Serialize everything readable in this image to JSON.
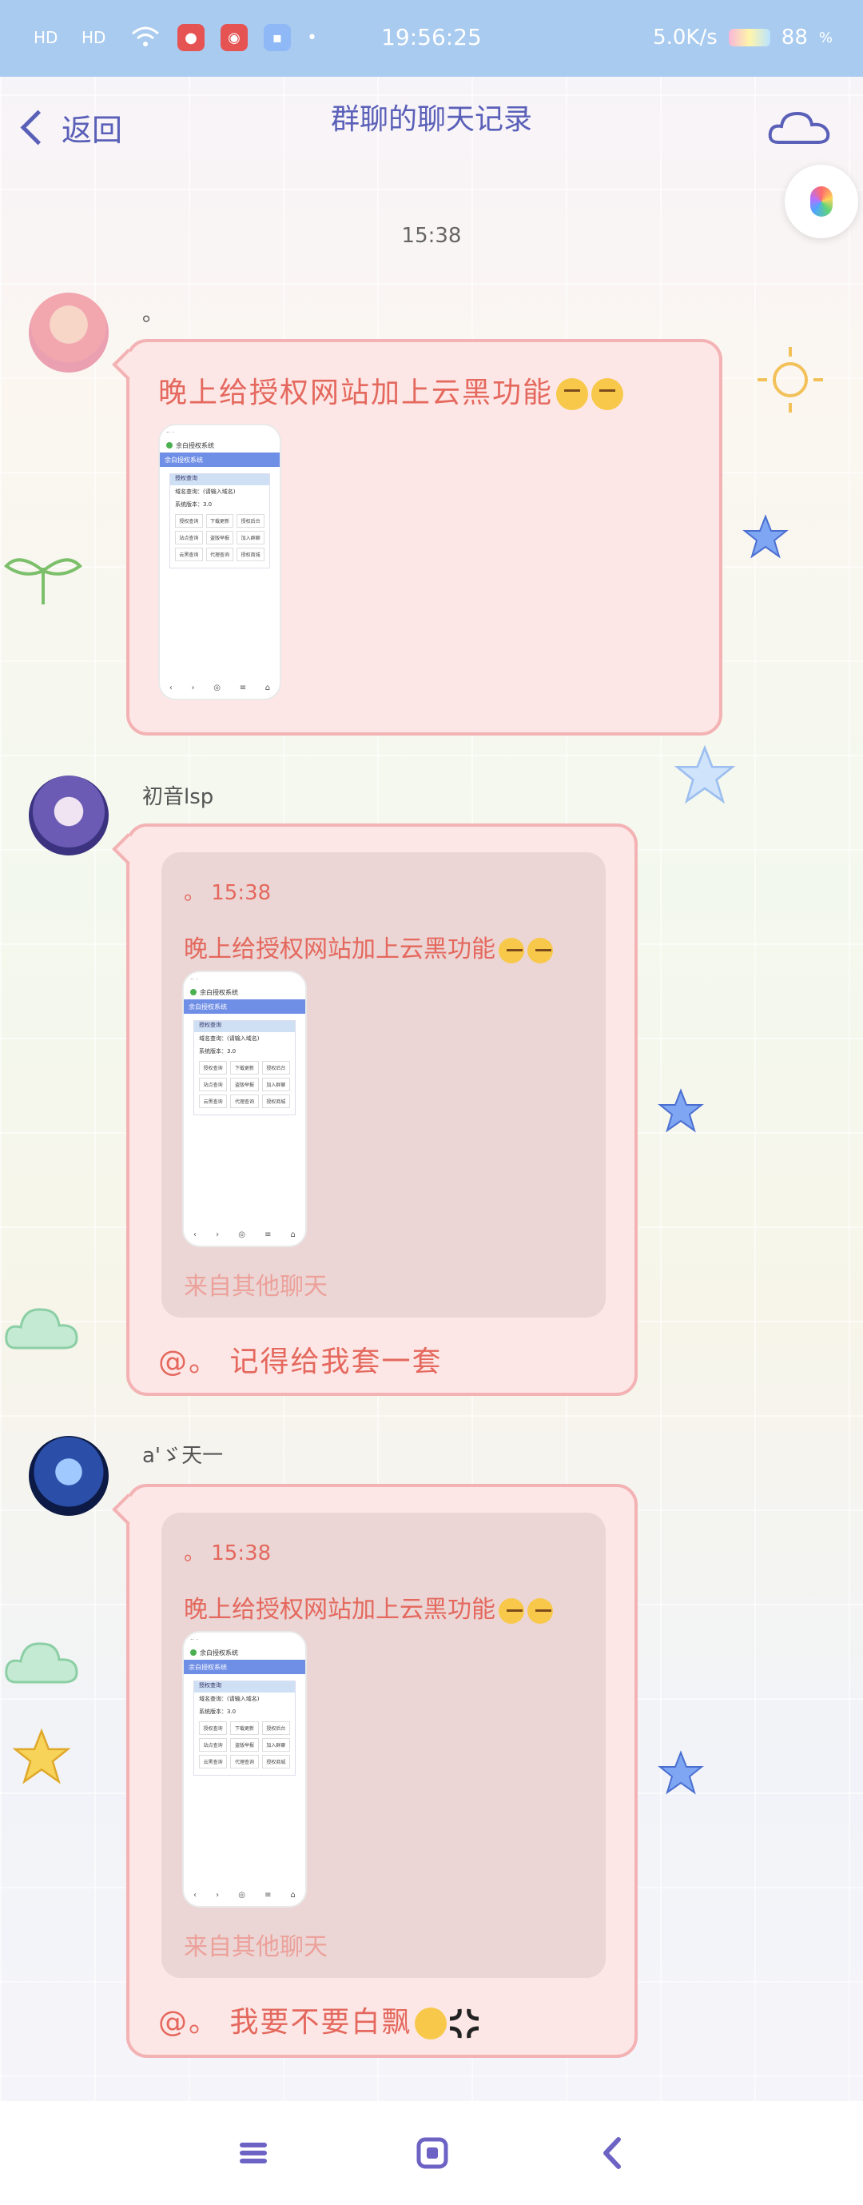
{
  "status_bar": {
    "signal_1": "HD",
    "signal_2": "HD",
    "time": "19:56:25",
    "net_speed": "5.0K/s",
    "battery": "88"
  },
  "header": {
    "back_label": "返回",
    "title": "群聊的聊天记录"
  },
  "timestamp": "15:38",
  "messages": [
    {
      "sender": "。",
      "text": "晚上给授权网站加上云黑功能"
    },
    {
      "sender": "初音lsp",
      "quote": {
        "sender_time": "。 15:38",
        "text": "晚上给授权网站加上云黑功能",
        "source": "来自其他聊天"
      },
      "reply": "@。 记得给我套一套"
    },
    {
      "sender": "a'ゞ天一",
      "quote": {
        "sender_time": "。 15:38",
        "text": "晚上给授权网站加上云黑功能",
        "source": "来自其他聊天"
      },
      "reply": "@。 我要不要白飘"
    }
  ],
  "thumbnail": {
    "url_text": "余白授权系统",
    "bar_text": "余白授权系统",
    "card_title": "授权查询",
    "row1": "域名查询：(请输入域名)",
    "row2": "系统版本：3.0",
    "grid": [
      "授权查询",
      "下载更新",
      "授权后台",
      "站点查询",
      "盗版举报",
      "加入群聊",
      "云黑查询",
      "代理查询",
      "授权商城"
    ]
  },
  "icons": {
    "back": "chevron-left-icon",
    "cloud": "cloud-icon",
    "mic": "mic-icon",
    "nav_menu": "menu-icon",
    "nav_home": "home-square-icon",
    "nav_back": "back-triangle-icon"
  },
  "colors": {
    "status_bar": "#a9cbef",
    "title": "#5a5fb8",
    "bubble_bg": "#fde7e6",
    "bubble_border": "#f3b2b4",
    "message_text": "#e4685d",
    "quote_bg": "#ebd6d5"
  }
}
